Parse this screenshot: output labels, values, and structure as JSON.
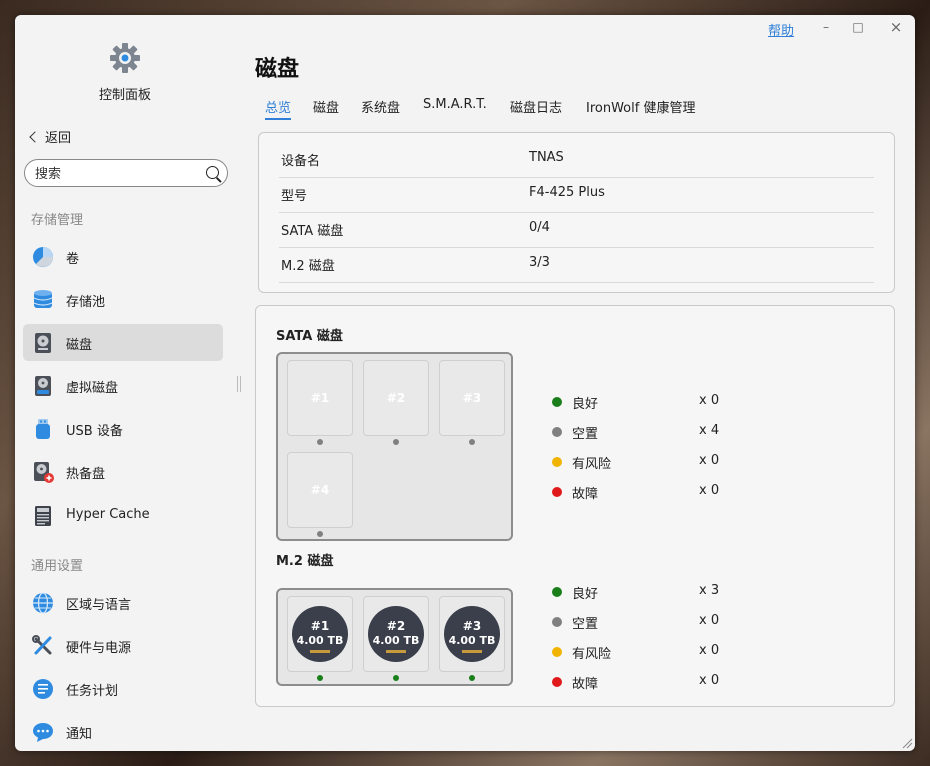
{
  "window": {
    "help_label": "帮助",
    "minimize_icon": "–",
    "maximize_icon": "□",
    "close_icon": "×"
  },
  "sidebar": {
    "app_title": "控制面板",
    "back_label": "返回",
    "search_placeholder": "搜索",
    "sections": [
      {
        "title": "存储管理"
      },
      {
        "title": "通用设置"
      }
    ],
    "storage_items": [
      {
        "label": "卷",
        "icon": "volume-pie-icon"
      },
      {
        "label": "存储池",
        "icon": "storage-pool-icon"
      },
      {
        "label": "磁盘",
        "icon": "disk-icon",
        "active": true
      },
      {
        "label": "虚拟磁盘",
        "icon": "virtual-disk-icon"
      },
      {
        "label": "USB 设备",
        "icon": "usb-icon"
      },
      {
        "label": "热备盘",
        "icon": "hot-spare-icon"
      },
      {
        "label": "Hyper Cache",
        "icon": "ssd-cache-icon"
      }
    ],
    "general_items": [
      {
        "label": "区域与语言",
        "icon": "globe-icon"
      },
      {
        "label": "硬件与电源",
        "icon": "tools-icon"
      },
      {
        "label": "任务计划",
        "icon": "task-list-icon"
      },
      {
        "label": "通知",
        "icon": "chat-bubble-icon"
      }
    ]
  },
  "main": {
    "title": "磁盘",
    "tabs": [
      {
        "label": "总览",
        "active": true
      },
      {
        "label": "磁盘"
      },
      {
        "label": "系统盘"
      },
      {
        "label": "S.M.A.R.T."
      },
      {
        "label": "磁盘日志"
      },
      {
        "label": "IronWolf 健康管理"
      }
    ],
    "info": [
      {
        "key": "设备名",
        "value": "TNAS"
      },
      {
        "key": "型号",
        "value": "F4-425 Plus"
      },
      {
        "key": "SATA 磁盘",
        "value": "0/4"
      },
      {
        "key": "M.2 磁盘",
        "value": "3/3"
      }
    ],
    "sata": {
      "title": "SATA 磁盘",
      "slots": [
        "#1",
        "#2",
        "#3",
        "#4"
      ],
      "legend": [
        {
          "label": "良好",
          "count": "x 0",
          "color": "#1a7f1a"
        },
        {
          "label": "空置",
          "count": "x 4",
          "color": "#808080"
        },
        {
          "label": "有风险",
          "count": "x 0",
          "color": "#f0b400"
        },
        {
          "label": "故障",
          "count": "x 0",
          "color": "#e01a1a"
        }
      ]
    },
    "m2": {
      "title": "M.2 磁盘",
      "slots": [
        {
          "num": "#1",
          "capacity": "4.00 TB"
        },
        {
          "num": "#2",
          "capacity": "4.00 TB"
        },
        {
          "num": "#3",
          "capacity": "4.00 TB"
        }
      ],
      "legend": [
        {
          "label": "良好",
          "count": "x 3",
          "color": "#1a7f1a"
        },
        {
          "label": "空置",
          "count": "x 0",
          "color": "#808080"
        },
        {
          "label": "有风险",
          "count": "x 0",
          "color": "#f0b400"
        },
        {
          "label": "故障",
          "count": "x 0",
          "color": "#e01a1a"
        }
      ]
    }
  }
}
